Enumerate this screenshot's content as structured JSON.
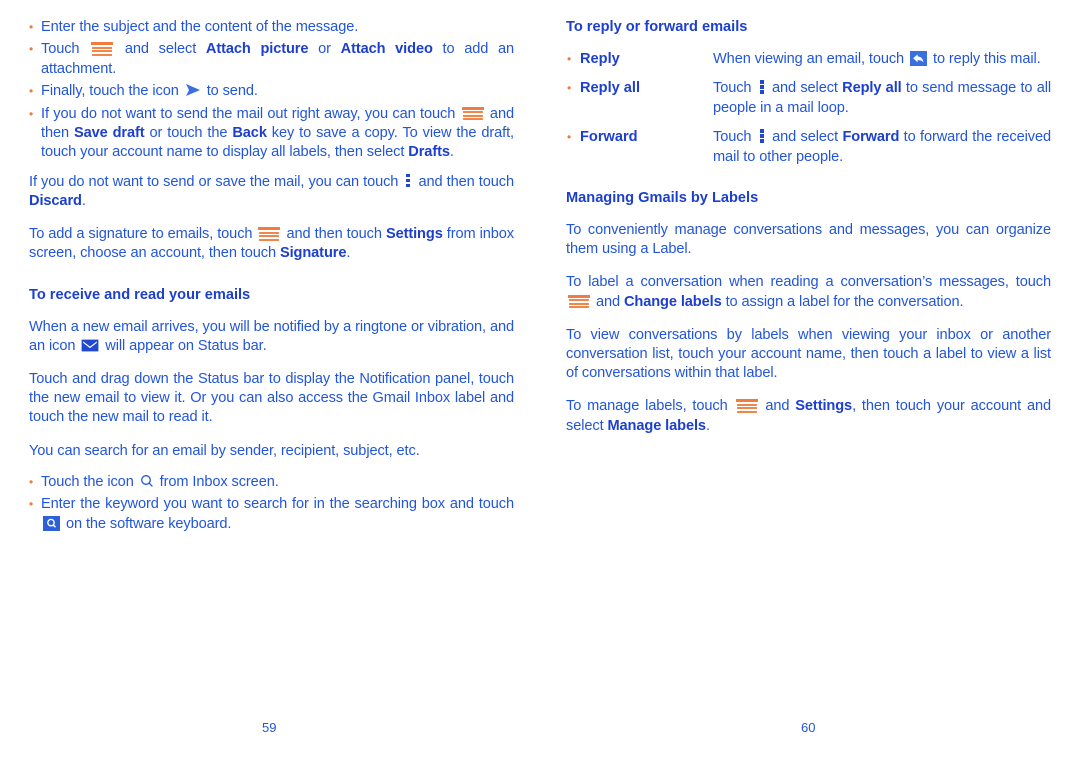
{
  "colors": {
    "text_blue": "#2255dd",
    "heading_blue": "#1c3fd0",
    "accent_orange": "#f2854a",
    "bullet_orange": "#f07a3c",
    "icon_button_blue": "#3a6fe0"
  },
  "left_page": {
    "folio": "59",
    "compose_bullets": [
      {
        "id": "enter-subject",
        "parts": [
          {
            "t": "text",
            "v": "Enter the subject and the content of the message."
          }
        ]
      },
      {
        "id": "attach",
        "parts": [
          {
            "t": "text",
            "v": "Touch "
          },
          {
            "t": "icon",
            "v": "menu-icon"
          },
          {
            "t": "text",
            "v": " and select "
          },
          {
            "t": "bold",
            "v": "Attach picture"
          },
          {
            "t": "text",
            "v": " or "
          },
          {
            "t": "bold",
            "v": "Attach video"
          },
          {
            "t": "text",
            "v": " to add an attachment."
          }
        ]
      },
      {
        "id": "send",
        "parts": [
          {
            "t": "text",
            "v": "Finally, touch the icon "
          },
          {
            "t": "icon",
            "v": "send-icon"
          },
          {
            "t": "text",
            "v": " to send."
          }
        ]
      },
      {
        "id": "save-draft",
        "parts": [
          {
            "t": "text",
            "v": "If you do not want to send the mail out right away, you can touch "
          },
          {
            "t": "icon",
            "v": "menu-icon"
          },
          {
            "t": "text",
            "v": " and then "
          },
          {
            "t": "bold",
            "v": "Save draft"
          },
          {
            "t": "text",
            "v": " or touch the "
          },
          {
            "t": "bold",
            "v": "Back"
          },
          {
            "t": "text",
            "v": " key to save a copy. To view the draft, touch your account name to display all labels, then select "
          },
          {
            "t": "bold",
            "v": "Drafts"
          },
          {
            "t": "text",
            "v": "."
          }
        ]
      }
    ],
    "discard_paragraph": [
      {
        "t": "text",
        "v": "If you do not want to send or save the mail, you can touch "
      },
      {
        "t": "icon",
        "v": "overflow-menu-icon"
      },
      {
        "t": "text",
        "v": " and then touch "
      },
      {
        "t": "bold",
        "v": "Discard"
      },
      {
        "t": "text",
        "v": "."
      }
    ],
    "signature_paragraph": [
      {
        "t": "text",
        "v": "To add a signature to emails, touch "
      },
      {
        "t": "icon",
        "v": "menu-icon"
      },
      {
        "t": "text",
        "v": " and then touch "
      },
      {
        "t": "bold",
        "v": "Settings"
      },
      {
        "t": "text",
        "v": " from inbox screen, choose an account, then touch "
      },
      {
        "t": "bold",
        "v": "Signature"
      },
      {
        "t": "text",
        "v": "."
      }
    ],
    "receive_heading": "To receive and read your emails",
    "notify_paragraph": [
      {
        "t": "text",
        "v": "When a new email arrives, you will be notified by a ringtone or vibration, and an icon "
      },
      {
        "t": "icon",
        "v": "new-mail-icon"
      },
      {
        "t": "text",
        "v": " will appear on Status bar."
      }
    ],
    "notification_panel_paragraph": [
      {
        "t": "text",
        "v": "Touch and drag down the Status bar to display the Notification panel, touch the new email to view it. Or you can also access the Gmail Inbox label and touch the new mail to read it."
      }
    ],
    "search_intro": "You can search for an email by sender, recipient, subject, etc.",
    "search_bullets": [
      {
        "id": "touch-search-icon",
        "parts": [
          {
            "t": "text",
            "v": "Touch the icon "
          },
          {
            "t": "icon",
            "v": "search-icon"
          },
          {
            "t": "text",
            "v": " from Inbox screen."
          }
        ]
      },
      {
        "id": "enter-keyword",
        "parts": [
          {
            "t": "text",
            "v": "Enter the keyword you want to search for in the searching box and touch "
          },
          {
            "t": "icon",
            "v": "search-button-icon"
          },
          {
            "t": "text",
            "v": " on the software keyboard."
          }
        ]
      }
    ]
  },
  "right_page": {
    "folio": "60",
    "reply_heading": "To reply or forward emails",
    "reply_rows": [
      {
        "term": "Reply",
        "desc": [
          {
            "t": "text",
            "v": "When viewing an email, touch "
          },
          {
            "t": "icon",
            "v": "reply-button-icon"
          },
          {
            "t": "text",
            "v": " to reply this mail."
          }
        ]
      },
      {
        "term": "Reply all",
        "desc": [
          {
            "t": "text",
            "v": "Touch "
          },
          {
            "t": "icon",
            "v": "overflow-menu-icon"
          },
          {
            "t": "text",
            "v": " and select "
          },
          {
            "t": "bold",
            "v": "Reply all"
          },
          {
            "t": "text",
            "v": " to send message to all people in a mail loop."
          }
        ]
      },
      {
        "term": "Forward",
        "desc": [
          {
            "t": "text",
            "v": "Touch "
          },
          {
            "t": "icon",
            "v": "overflow-menu-icon"
          },
          {
            "t": "text",
            "v": " and select "
          },
          {
            "t": "bold",
            "v": "Forward"
          },
          {
            "t": "text",
            "v": " to forward the received mail to other people."
          }
        ]
      }
    ],
    "labels_heading": "Managing Gmails by Labels",
    "labels_paragraphs": [
      {
        "id": "organize-with-label",
        "parts": [
          {
            "t": "text",
            "v": "To conveniently manage conversations and messages, you can organize them using a Label."
          }
        ]
      },
      {
        "id": "change-labels",
        "parts": [
          {
            "t": "text",
            "v": "To label a conversation when reading a conversation’s messages, touch "
          },
          {
            "t": "icon",
            "v": "menu-icon"
          },
          {
            "t": "text",
            "v": " and "
          },
          {
            "t": "bold",
            "v": "Change labels"
          },
          {
            "t": "text",
            "v": " to assign a label for the conversation."
          }
        ]
      },
      {
        "id": "view-by-labels",
        "parts": [
          {
            "t": "text",
            "v": "To view conversations by labels when viewing your inbox or another conversation list, touch your account name, then touch a label to view a list of conversations within that label."
          }
        ]
      },
      {
        "id": "manage-labels",
        "parts": [
          {
            "t": "text",
            "v": "To manage labels, touch "
          },
          {
            "t": "icon",
            "v": "menu-icon"
          },
          {
            "t": "text",
            "v": " and "
          },
          {
            "t": "bold",
            "v": "Settings"
          },
          {
            "t": "text",
            "v": ", then touch your account and select "
          },
          {
            "t": "bold",
            "v": "Manage labels"
          },
          {
            "t": "text",
            "v": "."
          }
        ]
      }
    ]
  }
}
